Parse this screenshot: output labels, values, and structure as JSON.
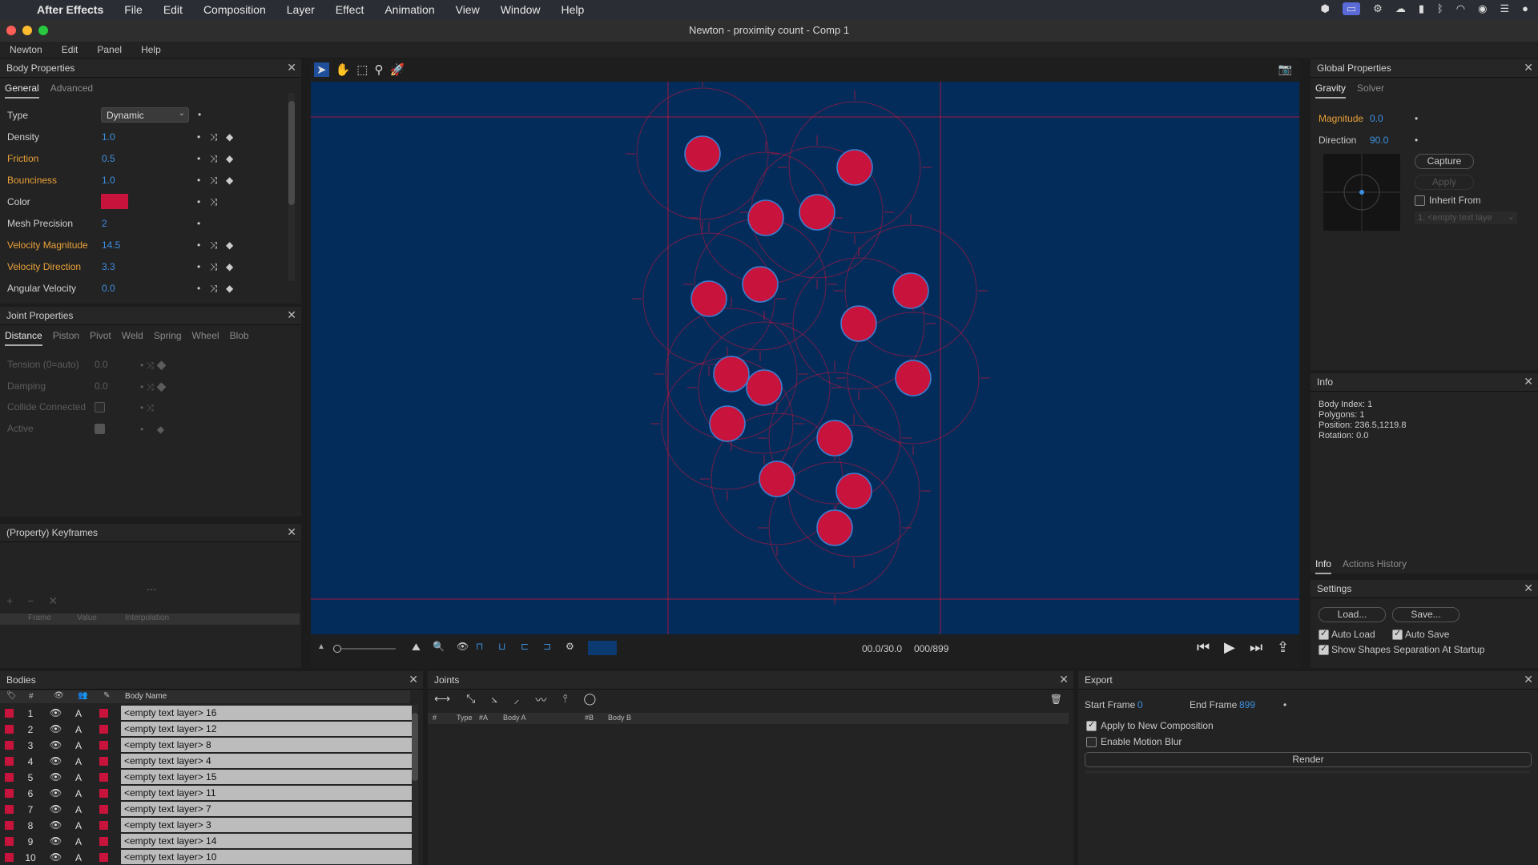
{
  "menubar": {
    "app": "After Effects",
    "items": [
      "File",
      "Edit",
      "Composition",
      "Layer",
      "Effect",
      "Animation",
      "View",
      "Window",
      "Help"
    ]
  },
  "window": {
    "title": "Newton - proximity count - Comp 1"
  },
  "app_menu": [
    "Newton",
    "Edit",
    "Panel",
    "Help"
  ],
  "body_props": {
    "title": "Body Properties",
    "tabs": [
      "General",
      "Advanced"
    ],
    "type_label": "Type",
    "type_value": "Dynamic",
    "rows": [
      {
        "label": "Density",
        "value": "1.0"
      },
      {
        "label": "Friction",
        "value": "0.5"
      },
      {
        "label": "Bounciness",
        "value": "1.0"
      },
      {
        "label": "Color",
        "value": ""
      },
      {
        "label": "Mesh Precision",
        "value": "2"
      },
      {
        "label": "Velocity Magnitude",
        "value": "14.5"
      },
      {
        "label": "Velocity Direction",
        "value": "3.3"
      },
      {
        "label": "Angular Velocity",
        "value": "0.0"
      }
    ],
    "color_swatch": "#c8143c"
  },
  "joint_props": {
    "title": "Joint Properties",
    "tabs": [
      "Distance",
      "Piston",
      "Pivot",
      "Weld",
      "Spring",
      "Wheel",
      "Blob"
    ],
    "rows": [
      {
        "label": "Tension (0=auto)",
        "value": "0.0"
      },
      {
        "label": "Damping",
        "value": "0.0"
      },
      {
        "label": "Collide Connected",
        "value": ""
      },
      {
        "label": "Active",
        "value": ""
      }
    ]
  },
  "keyframes": {
    "title": "(Property) Keyframes",
    "cols": [
      "Frame",
      "Value",
      "Interpolation"
    ]
  },
  "viewer": {
    "time": "00.0/30.0",
    "frame": "000/899",
    "bg": "#032c5b",
    "accent": "#c8143c"
  },
  "global_props": {
    "title": "Global Properties",
    "tabs": [
      "Gravity",
      "Solver"
    ],
    "magnitude_label": "Magnitude",
    "magnitude": "0.0",
    "direction_label": "Direction",
    "direction": "90.0",
    "capture": "Capture",
    "apply": "Apply",
    "inherit": "Inherit From",
    "inherit_sel": "1. <empty text laye"
  },
  "info": {
    "title": "Info",
    "lines": [
      "Body Index: 1",
      "Polygons: 1",
      "Position: 236.5,1219.8",
      "Rotation: 0.0"
    ],
    "tabs": [
      "Info",
      "Actions History"
    ]
  },
  "settings": {
    "title": "Settings",
    "load": "Load...",
    "save": "Save...",
    "auto_load": "Auto Load",
    "auto_save": "Auto Save",
    "show_sep": "Show Shapes Separation At Startup"
  },
  "bodies": {
    "title": "Bodies",
    "col_name": "Body Name",
    "col_num": "#",
    "rows": [
      {
        "n": "1",
        "name": "<empty text layer> 16"
      },
      {
        "n": "2",
        "name": "<empty text layer> 12"
      },
      {
        "n": "3",
        "name": "<empty text layer> 8"
      },
      {
        "n": "4",
        "name": "<empty text layer> 4"
      },
      {
        "n": "5",
        "name": "<empty text layer> 15"
      },
      {
        "n": "6",
        "name": "<empty text layer> 11"
      },
      {
        "n": "7",
        "name": "<empty text layer> 7"
      },
      {
        "n": "8",
        "name": "<empty text layer> 3"
      },
      {
        "n": "9",
        "name": "<empty text layer> 14"
      },
      {
        "n": "10",
        "name": "<empty text layer> 10"
      }
    ]
  },
  "joints": {
    "title": "Joints",
    "cols": [
      "#",
      "Type",
      "#A",
      "Body A",
      "#B",
      "Body B"
    ]
  },
  "export": {
    "title": "Export",
    "start_label": "Start Frame",
    "start": "0",
    "end_label": "End Frame",
    "end": "899",
    "apply_new": "Apply to New Composition",
    "motion_blur": "Enable Motion Blur",
    "render": "Render"
  }
}
